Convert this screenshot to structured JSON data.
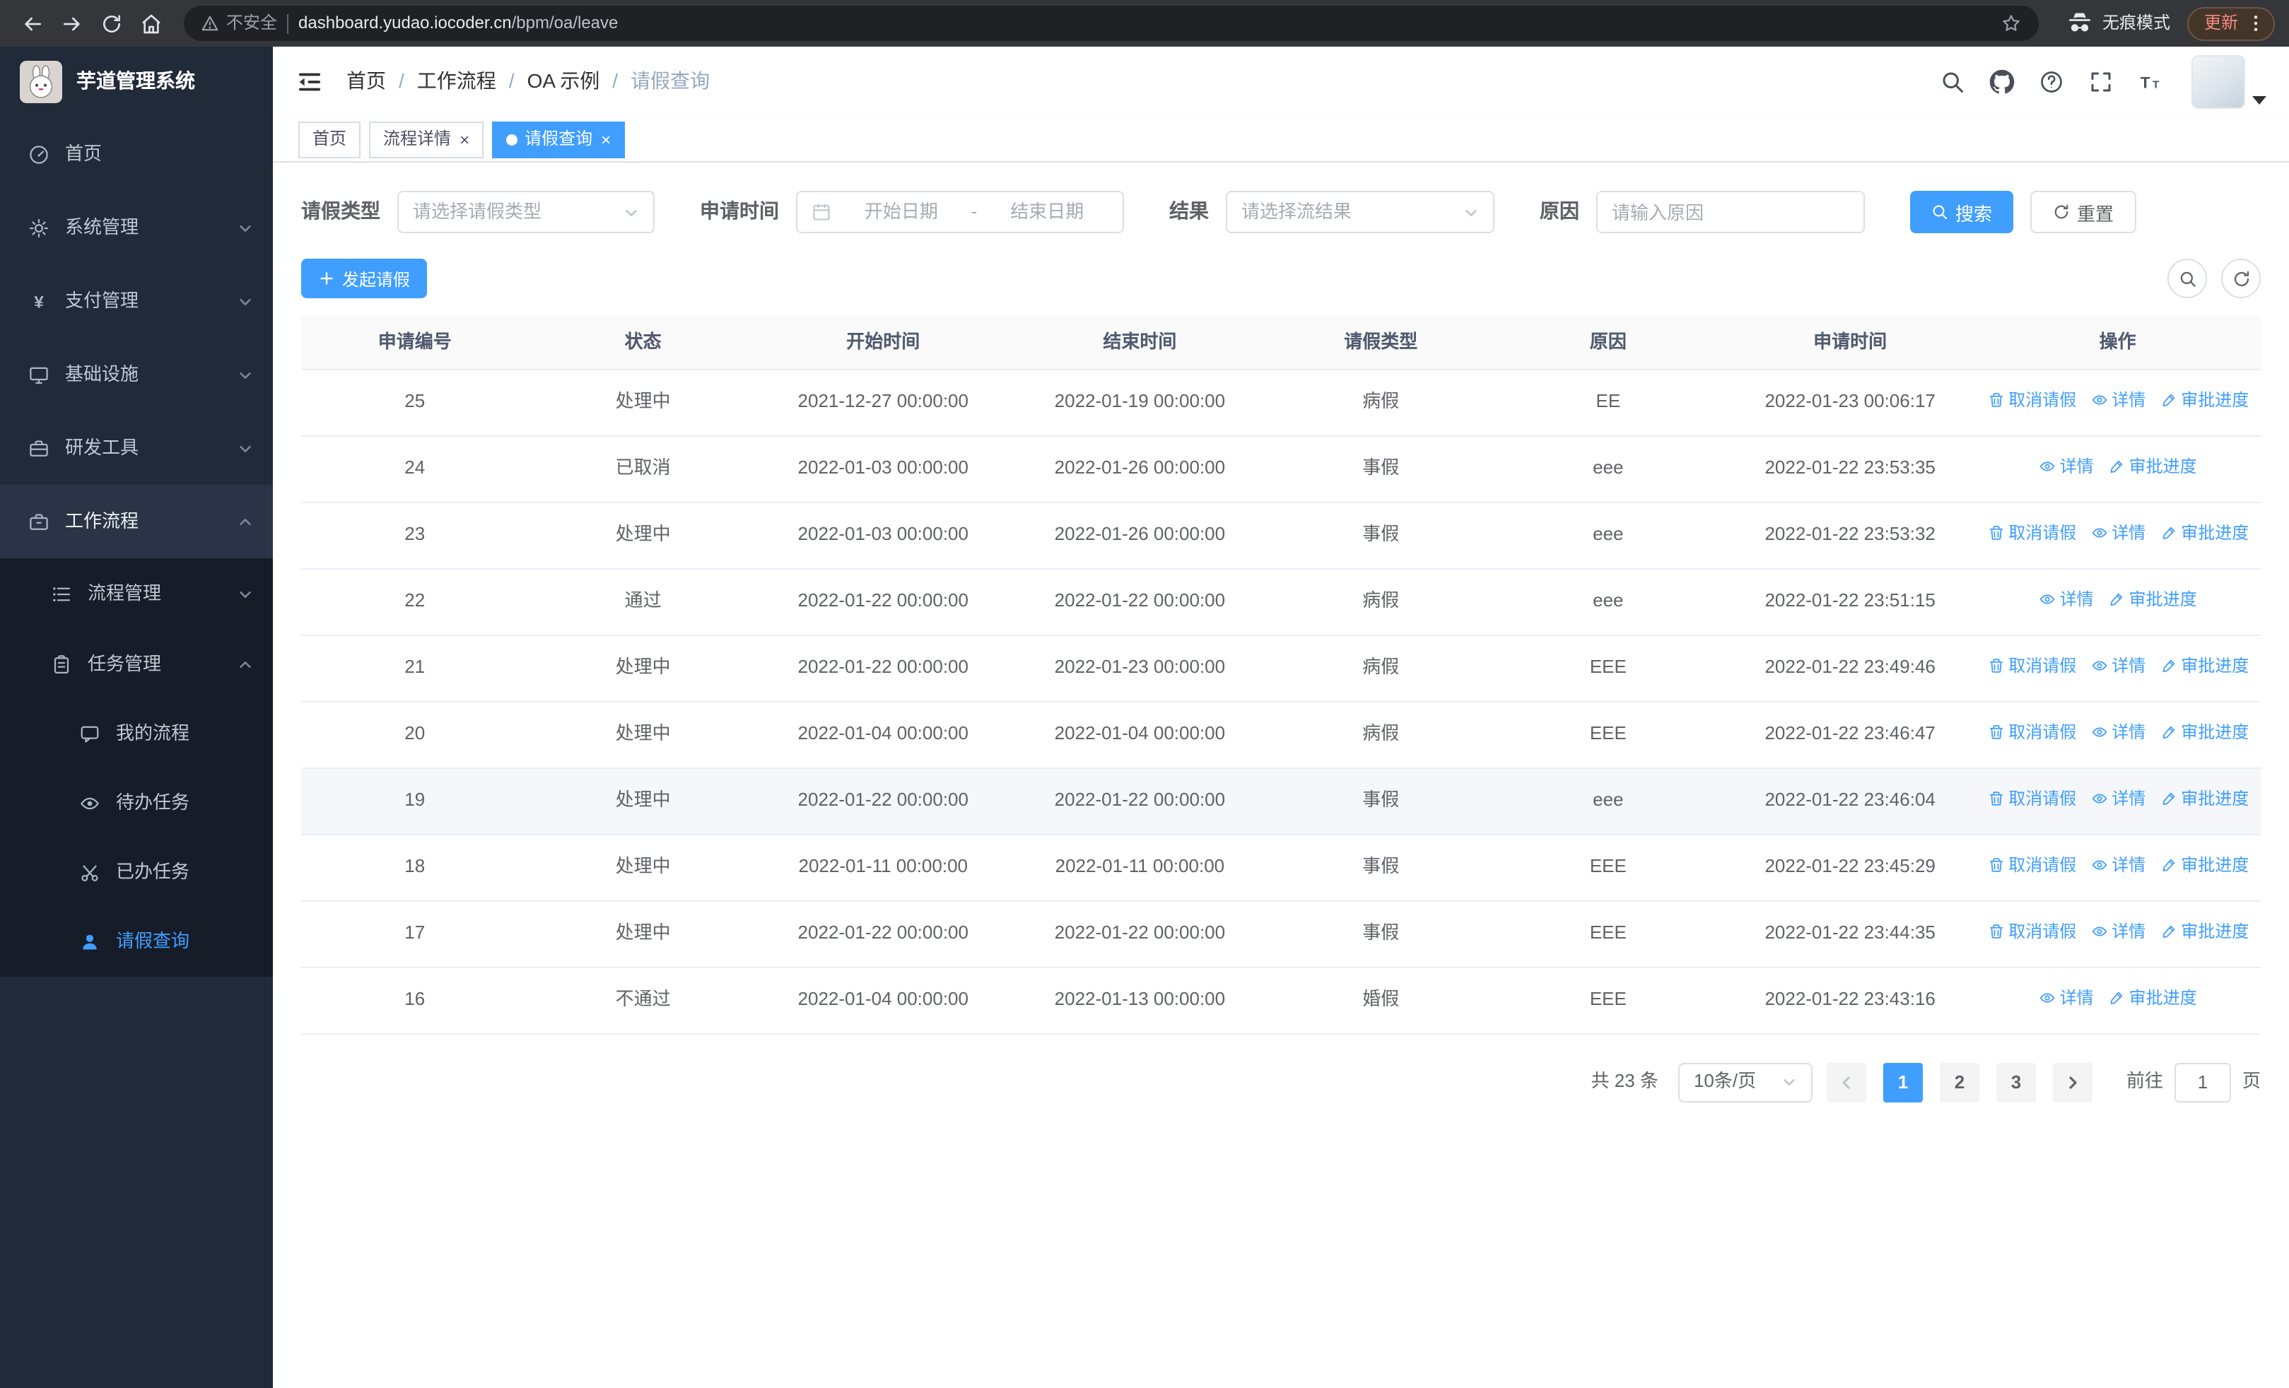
{
  "browser": {
    "security_warning": "不安全",
    "url_host": "dashboard.yudao.iocoder.cn",
    "url_path": "/bpm/oa/leave",
    "incognito_label": "无痕模式",
    "update_label": "更新"
  },
  "app": {
    "title": "芋道管理系统"
  },
  "colors": {
    "primary": "#409eff",
    "sidebar_bg": "#212a39",
    "sidebar_sub_bg": "#161d29"
  },
  "icons": {
    "close": "×"
  },
  "sidebar": {
    "items": [
      {
        "label": "首页"
      },
      {
        "label": "系统管理"
      },
      {
        "label": "支付管理"
      },
      {
        "label": "基础设施"
      },
      {
        "label": "研发工具"
      },
      {
        "label": "工作流程"
      }
    ],
    "submenu": [
      {
        "label": "流程管理"
      },
      {
        "label": "任务管理"
      }
    ],
    "task_items": [
      {
        "label": "我的流程"
      },
      {
        "label": "待办任务"
      },
      {
        "label": "已办任务"
      },
      {
        "label": "请假查询"
      }
    ]
  },
  "breadcrumb": {
    "separator": "/",
    "items": [
      "首页",
      "工作流程",
      "OA 示例",
      "请假查询"
    ]
  },
  "tabs": [
    {
      "label": "首页"
    },
    {
      "label": "流程详情"
    },
    {
      "label": "请假查询"
    }
  ],
  "filters": {
    "leave_type": {
      "label": "请假类型",
      "placeholder": "请选择请假类型"
    },
    "apply_time": {
      "label": "申请时间",
      "start_placeholder": "开始日期",
      "separator": "-",
      "end_placeholder": "结束日期"
    },
    "result": {
      "label": "结果",
      "placeholder": "请选择流结果"
    },
    "reason": {
      "label": "原因",
      "placeholder": "请输入原因"
    },
    "search_button": "搜索",
    "reset_button": "重置"
  },
  "toolbar": {
    "create_button": "发起请假"
  },
  "table": {
    "columns": [
      "申请编号",
      "状态",
      "开始时间",
      "结束时间",
      "请假类型",
      "原因",
      "申请时间",
      "操作"
    ],
    "action_labels": {
      "cancel": "取消请假",
      "detail": "详情",
      "progress": "审批进度"
    },
    "rows": [
      {
        "id": "25",
        "status": "处理中",
        "start_time": "2021-12-27 00:00:00",
        "end_time": "2022-01-19 00:00:00",
        "leave_type": "病假",
        "reason": "EE",
        "apply_time": "2022-01-23 00:06:17",
        "actions": [
          "cancel",
          "detail",
          "progress"
        ],
        "highlighted": false
      },
      {
        "id": "24",
        "status": "已取消",
        "start_time": "2022-01-03 00:00:00",
        "end_time": "2022-01-26 00:00:00",
        "leave_type": "事假",
        "reason": "eee",
        "apply_time": "2022-01-22 23:53:35",
        "actions": [
          "detail",
          "progress"
        ],
        "highlighted": false
      },
      {
        "id": "23",
        "status": "处理中",
        "start_time": "2022-01-03 00:00:00",
        "end_time": "2022-01-26 00:00:00",
        "leave_type": "事假",
        "reason": "eee",
        "apply_time": "2022-01-22 23:53:32",
        "actions": [
          "cancel",
          "detail",
          "progress"
        ],
        "highlighted": false
      },
      {
        "id": "22",
        "status": "通过",
        "start_time": "2022-01-22 00:00:00",
        "end_time": "2022-01-22 00:00:00",
        "leave_type": "病假",
        "reason": "eee",
        "apply_time": "2022-01-22 23:51:15",
        "actions": [
          "detail",
          "progress"
        ],
        "highlighted": false
      },
      {
        "id": "21",
        "status": "处理中",
        "start_time": "2022-01-22 00:00:00",
        "end_time": "2022-01-23 00:00:00",
        "leave_type": "病假",
        "reason": "EEE",
        "apply_time": "2022-01-22 23:49:46",
        "actions": [
          "cancel",
          "detail",
          "progress"
        ],
        "highlighted": false
      },
      {
        "id": "20",
        "status": "处理中",
        "start_time": "2022-01-04 00:00:00",
        "end_time": "2022-01-04 00:00:00",
        "leave_type": "病假",
        "reason": "EEE",
        "apply_time": "2022-01-22 23:46:47",
        "actions": [
          "cancel",
          "detail",
          "progress"
        ],
        "highlighted": false
      },
      {
        "id": "19",
        "status": "处理中",
        "start_time": "2022-01-22 00:00:00",
        "end_time": "2022-01-22 00:00:00",
        "leave_type": "事假",
        "reason": "eee",
        "apply_time": "2022-01-22 23:46:04",
        "actions": [
          "cancel",
          "detail",
          "progress"
        ],
        "highlighted": true
      },
      {
        "id": "18",
        "status": "处理中",
        "start_time": "2022-01-11 00:00:00",
        "end_time": "2022-01-11 00:00:00",
        "leave_type": "事假",
        "reason": "EEE",
        "apply_time": "2022-01-22 23:45:29",
        "actions": [
          "cancel",
          "detail",
          "progress"
        ],
        "highlighted": false
      },
      {
        "id": "17",
        "status": "处理中",
        "start_time": "2022-01-22 00:00:00",
        "end_time": "2022-01-22 00:00:00",
        "leave_type": "事假",
        "reason": "EEE",
        "apply_time": "2022-01-22 23:44:35",
        "actions": [
          "cancel",
          "detail",
          "progress"
        ],
        "highlighted": false
      },
      {
        "id": "16",
        "status": "不通过",
        "start_time": "2022-01-04 00:00:00",
        "end_time": "2022-01-13 00:00:00",
        "leave_type": "婚假",
        "reason": "EEE",
        "apply_time": "2022-01-22 23:43:16",
        "actions": [
          "detail",
          "progress"
        ],
        "highlighted": false
      }
    ]
  },
  "pagination": {
    "total": "共 23 条",
    "page_size": "10条/页",
    "pages": [
      "1",
      "2",
      "3"
    ],
    "active_page": "1",
    "goto_label": "前往",
    "goto_value": "1",
    "goto_unit": "页"
  }
}
